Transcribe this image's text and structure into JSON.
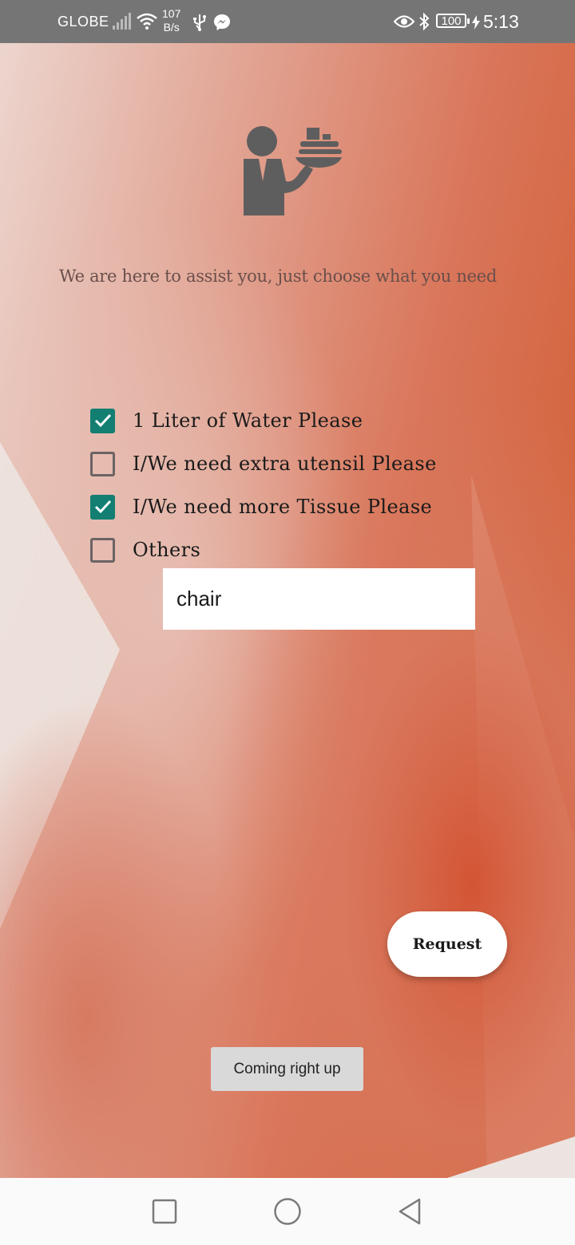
{
  "status_bar": {
    "carrier": "GLOBE",
    "net_speed_value": "107",
    "net_speed_unit": "B/s",
    "battery": "100",
    "time": "5:13",
    "icons": [
      "signal-icon",
      "wifi-icon",
      "usb-icon",
      "messenger-icon",
      "eye-icon",
      "bluetooth-icon",
      "battery-icon",
      "charging-icon"
    ]
  },
  "main": {
    "header_icon": "waiter-icon",
    "subtitle": "We are here to assist you, just choose what you need",
    "options": [
      {
        "label": "1 Liter of Water Please",
        "checked": true
      },
      {
        "label": "I/We need extra utensil Please",
        "checked": false
      },
      {
        "label": "I/We need more Tissue Please",
        "checked": true
      },
      {
        "label": "Others",
        "checked": false
      }
    ],
    "others_input_value": "chair",
    "request_button": "Request",
    "toast": "Coming right up"
  },
  "nav_bar": {
    "icons": [
      "recents-icon",
      "home-icon",
      "back-icon"
    ]
  },
  "colors": {
    "accent": "#127f72",
    "background_warm": "#d4593a",
    "status_bar": "#757575"
  }
}
